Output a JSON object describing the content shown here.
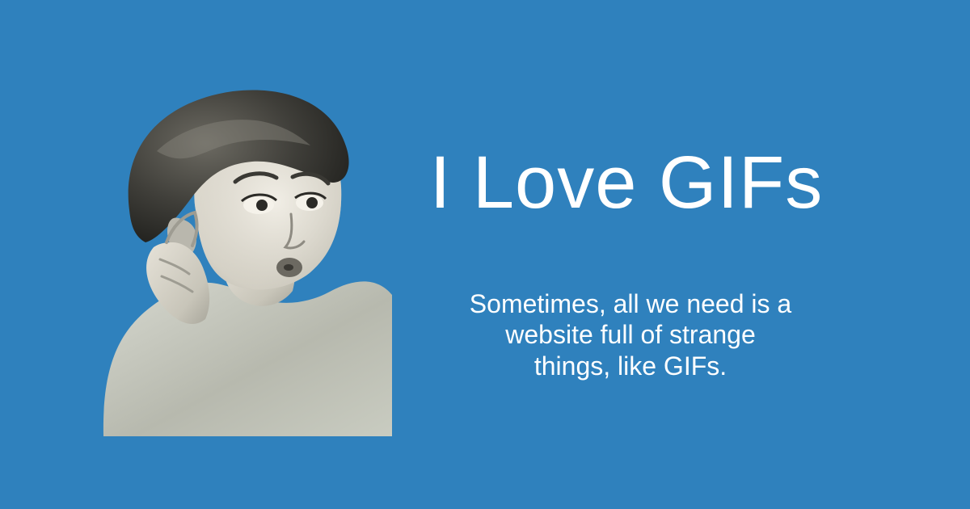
{
  "colors": {
    "background": "#2f81bd",
    "text": "#ffffff",
    "photo_tint_light": "#d9dccf",
    "photo_tint_dark": "#2b2a26"
  },
  "photo": {
    "icon": "woman-cupping-ear-photo"
  },
  "title": "I Love GIFs",
  "subtitle": {
    "lines": [
      "Sometimes, all we need is a",
      "website full of strange",
      "things, like GIFs."
    ]
  }
}
